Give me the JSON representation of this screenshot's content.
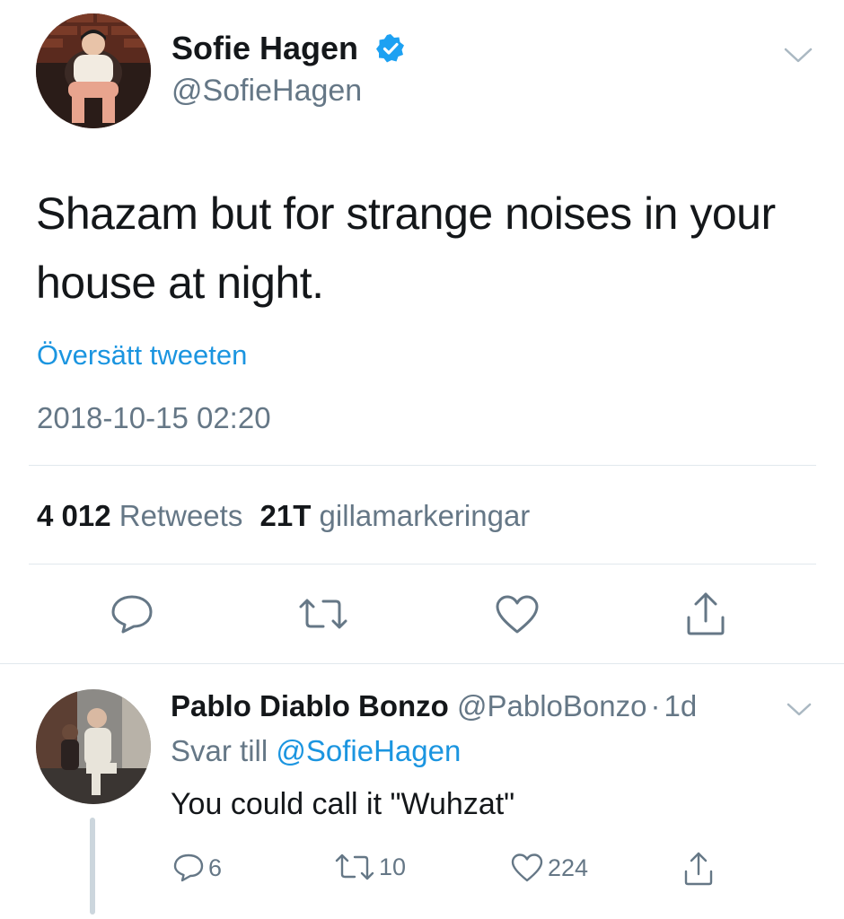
{
  "tweet": {
    "author_name": "Sofie Hagen",
    "author_handle": "@SofieHagen",
    "text_line1": "Shazam but for strange noises in your",
    "text_line2": "house at night.",
    "translate_label": "Översätt tweeten",
    "timestamp": "2018-10-15 02:20",
    "retweet_count": "4 012",
    "retweet_label": "Retweets",
    "like_count": "21T",
    "like_label": "gillamarkeringar"
  },
  "reply": {
    "author_name": "Pablo Diablo Bonzo",
    "author_handle": "@PabloBonzo",
    "separator": "·",
    "age": "1d",
    "reply_to_label": "Svar till",
    "reply_to_handle": "@SofieHagen",
    "text": "You could call it \"Wuhzat\"",
    "reply_count": "6",
    "retweet_count": "10",
    "like_count": "224"
  },
  "colors": {
    "link_blue": "#1b95e0",
    "meta_grey": "#657786",
    "divider": "#e1e8ed",
    "verified": "#1da1f2"
  },
  "icons": [
    "chevron-down-icon",
    "verified-badge-icon",
    "reply-icon",
    "retweet-icon",
    "like-icon",
    "share-icon"
  ]
}
